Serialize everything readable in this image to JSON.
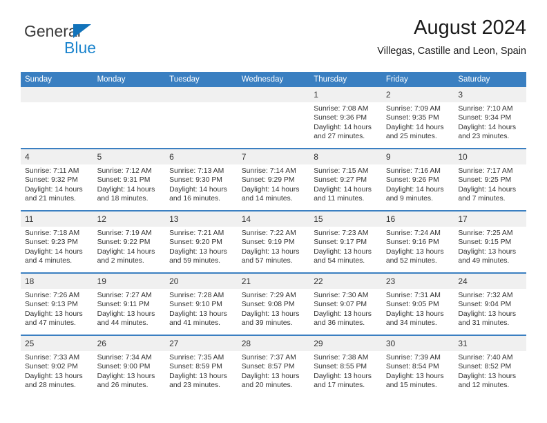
{
  "brand": {
    "name_part1": "General",
    "name_part2": "Blue",
    "triangle_color": "#1273ba",
    "blue_color": "#1b84cd"
  },
  "header": {
    "title": "August 2024",
    "subtitle": "Villegas, Castille and Leon, Spain"
  },
  "theme": {
    "header_bg": "#3a7fc1",
    "daynum_bg": "#f0f0f0",
    "row_rule": "#3a7fc1",
    "text": "#333333"
  },
  "weekday_headers": [
    "Sunday",
    "Monday",
    "Tuesday",
    "Wednesday",
    "Thursday",
    "Friday",
    "Saturday"
  ],
  "weeks": [
    [
      {
        "day": "",
        "sunrise": "",
        "sunset": "",
        "daylight": ""
      },
      {
        "day": "",
        "sunrise": "",
        "sunset": "",
        "daylight": ""
      },
      {
        "day": "",
        "sunrise": "",
        "sunset": "",
        "daylight": ""
      },
      {
        "day": "",
        "sunrise": "",
        "sunset": "",
        "daylight": ""
      },
      {
        "day": "1",
        "sunrise": "Sunrise: 7:08 AM",
        "sunset": "Sunset: 9:36 PM",
        "daylight": "Daylight: 14 hours and 27 minutes."
      },
      {
        "day": "2",
        "sunrise": "Sunrise: 7:09 AM",
        "sunset": "Sunset: 9:35 PM",
        "daylight": "Daylight: 14 hours and 25 minutes."
      },
      {
        "day": "3",
        "sunrise": "Sunrise: 7:10 AM",
        "sunset": "Sunset: 9:34 PM",
        "daylight": "Daylight: 14 hours and 23 minutes."
      }
    ],
    [
      {
        "day": "4",
        "sunrise": "Sunrise: 7:11 AM",
        "sunset": "Sunset: 9:32 PM",
        "daylight": "Daylight: 14 hours and 21 minutes."
      },
      {
        "day": "5",
        "sunrise": "Sunrise: 7:12 AM",
        "sunset": "Sunset: 9:31 PM",
        "daylight": "Daylight: 14 hours and 18 minutes."
      },
      {
        "day": "6",
        "sunrise": "Sunrise: 7:13 AM",
        "sunset": "Sunset: 9:30 PM",
        "daylight": "Daylight: 14 hours and 16 minutes."
      },
      {
        "day": "7",
        "sunrise": "Sunrise: 7:14 AM",
        "sunset": "Sunset: 9:29 PM",
        "daylight": "Daylight: 14 hours and 14 minutes."
      },
      {
        "day": "8",
        "sunrise": "Sunrise: 7:15 AM",
        "sunset": "Sunset: 9:27 PM",
        "daylight": "Daylight: 14 hours and 11 minutes."
      },
      {
        "day": "9",
        "sunrise": "Sunrise: 7:16 AM",
        "sunset": "Sunset: 9:26 PM",
        "daylight": "Daylight: 14 hours and 9 minutes."
      },
      {
        "day": "10",
        "sunrise": "Sunrise: 7:17 AM",
        "sunset": "Sunset: 9:25 PM",
        "daylight": "Daylight: 14 hours and 7 minutes."
      }
    ],
    [
      {
        "day": "11",
        "sunrise": "Sunrise: 7:18 AM",
        "sunset": "Sunset: 9:23 PM",
        "daylight": "Daylight: 14 hours and 4 minutes."
      },
      {
        "day": "12",
        "sunrise": "Sunrise: 7:19 AM",
        "sunset": "Sunset: 9:22 PM",
        "daylight": "Daylight: 14 hours and 2 minutes."
      },
      {
        "day": "13",
        "sunrise": "Sunrise: 7:21 AM",
        "sunset": "Sunset: 9:20 PM",
        "daylight": "Daylight: 13 hours and 59 minutes."
      },
      {
        "day": "14",
        "sunrise": "Sunrise: 7:22 AM",
        "sunset": "Sunset: 9:19 PM",
        "daylight": "Daylight: 13 hours and 57 minutes."
      },
      {
        "day": "15",
        "sunrise": "Sunrise: 7:23 AM",
        "sunset": "Sunset: 9:17 PM",
        "daylight": "Daylight: 13 hours and 54 minutes."
      },
      {
        "day": "16",
        "sunrise": "Sunrise: 7:24 AM",
        "sunset": "Sunset: 9:16 PM",
        "daylight": "Daylight: 13 hours and 52 minutes."
      },
      {
        "day": "17",
        "sunrise": "Sunrise: 7:25 AM",
        "sunset": "Sunset: 9:15 PM",
        "daylight": "Daylight: 13 hours and 49 minutes."
      }
    ],
    [
      {
        "day": "18",
        "sunrise": "Sunrise: 7:26 AM",
        "sunset": "Sunset: 9:13 PM",
        "daylight": "Daylight: 13 hours and 47 minutes."
      },
      {
        "day": "19",
        "sunrise": "Sunrise: 7:27 AM",
        "sunset": "Sunset: 9:11 PM",
        "daylight": "Daylight: 13 hours and 44 minutes."
      },
      {
        "day": "20",
        "sunrise": "Sunrise: 7:28 AM",
        "sunset": "Sunset: 9:10 PM",
        "daylight": "Daylight: 13 hours and 41 minutes."
      },
      {
        "day": "21",
        "sunrise": "Sunrise: 7:29 AM",
        "sunset": "Sunset: 9:08 PM",
        "daylight": "Daylight: 13 hours and 39 minutes."
      },
      {
        "day": "22",
        "sunrise": "Sunrise: 7:30 AM",
        "sunset": "Sunset: 9:07 PM",
        "daylight": "Daylight: 13 hours and 36 minutes."
      },
      {
        "day": "23",
        "sunrise": "Sunrise: 7:31 AM",
        "sunset": "Sunset: 9:05 PM",
        "daylight": "Daylight: 13 hours and 34 minutes."
      },
      {
        "day": "24",
        "sunrise": "Sunrise: 7:32 AM",
        "sunset": "Sunset: 9:04 PM",
        "daylight": "Daylight: 13 hours and 31 minutes."
      }
    ],
    [
      {
        "day": "25",
        "sunrise": "Sunrise: 7:33 AM",
        "sunset": "Sunset: 9:02 PM",
        "daylight": "Daylight: 13 hours and 28 minutes."
      },
      {
        "day": "26",
        "sunrise": "Sunrise: 7:34 AM",
        "sunset": "Sunset: 9:00 PM",
        "daylight": "Daylight: 13 hours and 26 minutes."
      },
      {
        "day": "27",
        "sunrise": "Sunrise: 7:35 AM",
        "sunset": "Sunset: 8:59 PM",
        "daylight": "Daylight: 13 hours and 23 minutes."
      },
      {
        "day": "28",
        "sunrise": "Sunrise: 7:37 AM",
        "sunset": "Sunset: 8:57 PM",
        "daylight": "Daylight: 13 hours and 20 minutes."
      },
      {
        "day": "29",
        "sunrise": "Sunrise: 7:38 AM",
        "sunset": "Sunset: 8:55 PM",
        "daylight": "Daylight: 13 hours and 17 minutes."
      },
      {
        "day": "30",
        "sunrise": "Sunrise: 7:39 AM",
        "sunset": "Sunset: 8:54 PM",
        "daylight": "Daylight: 13 hours and 15 minutes."
      },
      {
        "day": "31",
        "sunrise": "Sunrise: 7:40 AM",
        "sunset": "Sunset: 8:52 PM",
        "daylight": "Daylight: 13 hours and 12 minutes."
      }
    ]
  ]
}
